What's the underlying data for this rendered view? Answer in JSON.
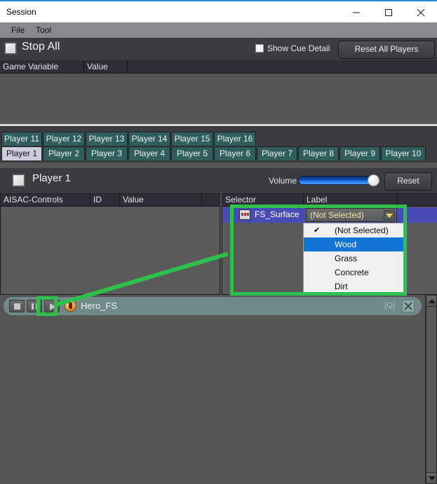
{
  "window": {
    "title": "Session",
    "minimize_icon": "minimize-icon",
    "maximize_icon": "maximize-icon",
    "close_icon": "close-icon",
    "accent_color": "#1e8ad6"
  },
  "menubar": {
    "items": [
      {
        "label": "File"
      },
      {
        "label": "Tool"
      }
    ]
  },
  "toolbar": {
    "stop_all_label": "Stop All",
    "show_cue_detail_label": "Show Cue Detail",
    "show_cue_detail_checked": false,
    "reset_all_players_label": "Reset All Players"
  },
  "game_variable_table": {
    "columns": [
      "Game Variable",
      "Value",
      ""
    ],
    "rows": []
  },
  "tabs": {
    "top_row": [
      {
        "label": "Player 11",
        "active": false
      },
      {
        "label": "Player 12",
        "active": false
      },
      {
        "label": "Player 13",
        "active": false
      },
      {
        "label": "Player 14",
        "active": false
      },
      {
        "label": "Player 15",
        "active": false
      },
      {
        "label": "Player 16",
        "active": false
      }
    ],
    "bottom_row": [
      {
        "label": "Player 1",
        "active": true
      },
      {
        "label": "Player 2",
        "active": false
      },
      {
        "label": "Player 3",
        "active": false
      },
      {
        "label": "Player 4",
        "active": false
      },
      {
        "label": "Player 5",
        "active": false
      },
      {
        "label": "Player 6",
        "active": false
      },
      {
        "label": "Player 7",
        "active": false
      },
      {
        "label": "Player 8",
        "active": false
      },
      {
        "label": "Player 9",
        "active": false
      },
      {
        "label": "Player 10",
        "active": false
      }
    ]
  },
  "player_header": {
    "name": "Player 1",
    "enabled_checkbox": false,
    "volume_label": "Volume",
    "volume_percent": 86,
    "reset_label": "Reset"
  },
  "aisac_grid": {
    "columns": [
      "AISAC-Controls",
      "ID",
      "Value",
      ""
    ],
    "rows": []
  },
  "selector_grid": {
    "columns": [
      "Selector",
      "Label",
      ""
    ],
    "rows": [
      {
        "icon": "selector-icon",
        "name": "FS_Surface",
        "label_value": "(Not Selected)",
        "selected": true
      }
    ]
  },
  "dropdown": {
    "open": true,
    "check_glyph": "✔",
    "items": [
      {
        "label": "(Not Selected)",
        "checked": true,
        "highlighted": false
      },
      {
        "label": "Wood",
        "checked": false,
        "highlighted": true
      },
      {
        "label": "Grass",
        "checked": false,
        "highlighted": false
      },
      {
        "label": "Concrete",
        "checked": false,
        "highlighted": false
      },
      {
        "label": "Dirt",
        "checked": false,
        "highlighted": false
      }
    ]
  },
  "cue_bar": {
    "stop_icon": "stop-icon",
    "pause_icon": "pause-icon",
    "play_icon": "play-icon",
    "cue_icon": "cue-icon",
    "cue_name": "Hero_FS",
    "quantize_tag": "[Q]",
    "close_icon": "close-icon"
  },
  "annotations": {
    "highlight_color": "#2ec04a",
    "selector_box_label": "selector-dropdown-highlight",
    "play_box_label": "play-button-highlight"
  },
  "scrollbar": {
    "up_icon": "arrow-up-icon",
    "down_icon": "arrow-down-icon"
  }
}
